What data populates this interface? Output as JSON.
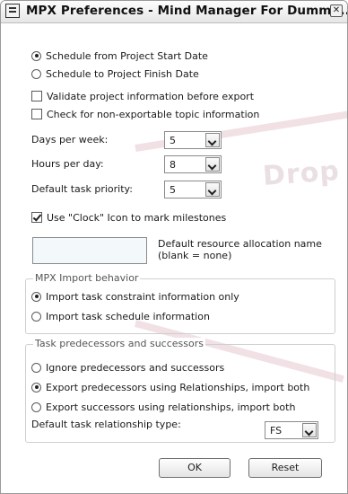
{
  "window": {
    "title": "MPX Preferences - Mind Manager For Dummi...",
    "close_icon": "close-icon"
  },
  "watermark": {
    "text": "Drop"
  },
  "schedule": {
    "options": [
      {
        "label": "Schedule from Project Start Date",
        "selected": true
      },
      {
        "label": "Schedule to Project Finish Date",
        "selected": false
      }
    ]
  },
  "export_checks": [
    {
      "label": "Validate project information before export",
      "checked": false
    },
    {
      "label": "Check for non-exportable topic information",
      "checked": false
    }
  ],
  "fields": {
    "days_per_week": {
      "label": "Days per week:",
      "value": "5"
    },
    "hours_per_day": {
      "label": "Hours per day:",
      "value": "8"
    },
    "default_priority": {
      "label": "Default task priority:",
      "value": "5"
    }
  },
  "clock_checkbox": {
    "label": "Use \"Clock\" Icon to mark milestones",
    "checked": true
  },
  "resource": {
    "value": "",
    "label_line1": "Default resource allocation name",
    "label_line2": "(blank = none)"
  },
  "import_group": {
    "title": "MPX Import behavior",
    "options": [
      {
        "label": "Import task constraint information only",
        "selected": true
      },
      {
        "label": "Import task schedule information",
        "selected": false
      }
    ]
  },
  "pred_group": {
    "title": "Task predecessors and successors",
    "options": [
      {
        "label": "Ignore predecessors and successors",
        "selected": false
      },
      {
        "label": "Export predecessors using Relationships, import both",
        "selected": true
      },
      {
        "label": "Export successors using relationships, import both",
        "selected": false
      }
    ],
    "relationship_label": "Default task relationship type:",
    "relationship_value": "FS"
  },
  "buttons": {
    "ok": "OK",
    "reset": "Reset"
  }
}
